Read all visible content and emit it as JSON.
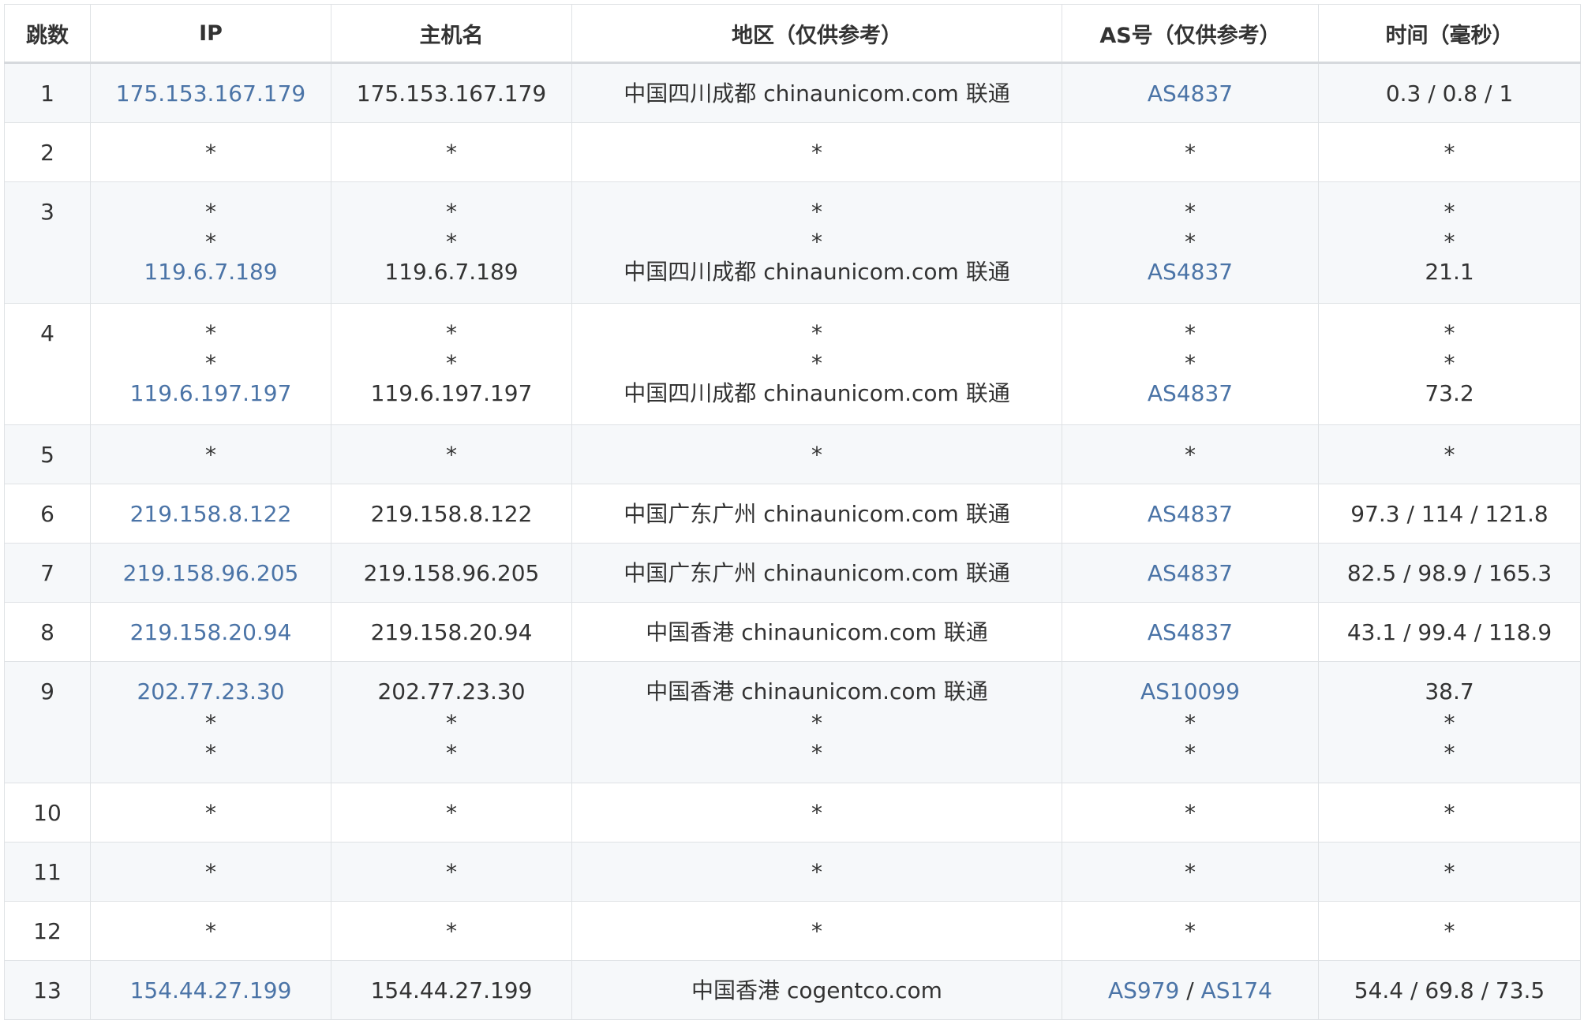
{
  "headers": [
    "跳数",
    "IP",
    "主机名",
    "地区（仅供参考）",
    "AS号（仅供参考）",
    "时间（毫秒）"
  ],
  "rows": [
    {
      "hop": "1",
      "lines": [
        {
          "ip": "175.153.167.179",
          "host": "175.153.167.179",
          "region": "中国四川成都 chinaunicom.com 联通",
          "as": [
            "AS4837"
          ],
          "time": "0.3 / 0.8 / 1"
        }
      ]
    },
    {
      "hop": "2",
      "lines": [
        {
          "ip": "*",
          "host": "*",
          "region": "*",
          "as": [
            "*"
          ],
          "time": "*"
        }
      ]
    },
    {
      "hop": "3",
      "lines": [
        {
          "ip": "*",
          "host": "*",
          "region": "*",
          "as": [
            "*"
          ],
          "time": "*"
        },
        {
          "ip": "*",
          "host": "*",
          "region": "*",
          "as": [
            "*"
          ],
          "time": "*"
        },
        {
          "ip": "119.6.7.189",
          "host": "119.6.7.189",
          "region": "中国四川成都 chinaunicom.com 联通",
          "as": [
            "AS4837"
          ],
          "time": "21.1"
        }
      ]
    },
    {
      "hop": "4",
      "lines": [
        {
          "ip": "*",
          "host": "*",
          "region": "*",
          "as": [
            "*"
          ],
          "time": "*"
        },
        {
          "ip": "*",
          "host": "*",
          "region": "*",
          "as": [
            "*"
          ],
          "time": "*"
        },
        {
          "ip": "119.6.197.197",
          "host": "119.6.197.197",
          "region": "中国四川成都 chinaunicom.com 联通",
          "as": [
            "AS4837"
          ],
          "time": "73.2"
        }
      ]
    },
    {
      "hop": "5",
      "lines": [
        {
          "ip": "*",
          "host": "*",
          "region": "*",
          "as": [
            "*"
          ],
          "time": "*"
        }
      ]
    },
    {
      "hop": "6",
      "lines": [
        {
          "ip": "219.158.8.122",
          "host": "219.158.8.122",
          "region": "中国广东广州 chinaunicom.com 联通",
          "as": [
            "AS4837"
          ],
          "time": "97.3 / 114 / 121.8"
        }
      ]
    },
    {
      "hop": "7",
      "lines": [
        {
          "ip": "219.158.96.205",
          "host": "219.158.96.205",
          "region": "中国广东广州 chinaunicom.com 联通",
          "as": [
            "AS4837"
          ],
          "time": "82.5 / 98.9 / 165.3"
        }
      ]
    },
    {
      "hop": "8",
      "lines": [
        {
          "ip": "219.158.20.94",
          "host": "219.158.20.94",
          "region": "中国香港 chinaunicom.com 联通",
          "as": [
            "AS4837"
          ],
          "time": "43.1 / 99.4 / 118.9"
        }
      ]
    },
    {
      "hop": "9",
      "lines": [
        {
          "ip": "202.77.23.30",
          "host": "202.77.23.30",
          "region": "中国香港 chinaunicom.com 联通",
          "as": [
            "AS10099"
          ],
          "time": "38.7"
        },
        {
          "ip": "*",
          "host": "*",
          "region": "*",
          "as": [
            "*"
          ],
          "time": "*"
        },
        {
          "ip": "*",
          "host": "*",
          "region": "*",
          "as": [
            "*"
          ],
          "time": "*"
        }
      ]
    },
    {
      "hop": "10",
      "lines": [
        {
          "ip": "*",
          "host": "*",
          "region": "*",
          "as": [
            "*"
          ],
          "time": "*"
        }
      ]
    },
    {
      "hop": "11",
      "lines": [
        {
          "ip": "*",
          "host": "*",
          "region": "*",
          "as": [
            "*"
          ],
          "time": "*"
        }
      ]
    },
    {
      "hop": "12",
      "lines": [
        {
          "ip": "*",
          "host": "*",
          "region": "*",
          "as": [
            "*"
          ],
          "time": "*"
        }
      ]
    },
    {
      "hop": "13",
      "lines": [
        {
          "ip": "154.44.27.199",
          "host": "154.44.27.199",
          "region": "中国香港 cogentco.com",
          "as": [
            "AS979",
            "AS174"
          ],
          "time": "54.4 / 69.8 / 73.5"
        }
      ]
    }
  ],
  "colors": {
    "link": "#4b74a7",
    "text": "#333333",
    "stripe": "#f6f8fa",
    "border": "#dfe2e5"
  }
}
